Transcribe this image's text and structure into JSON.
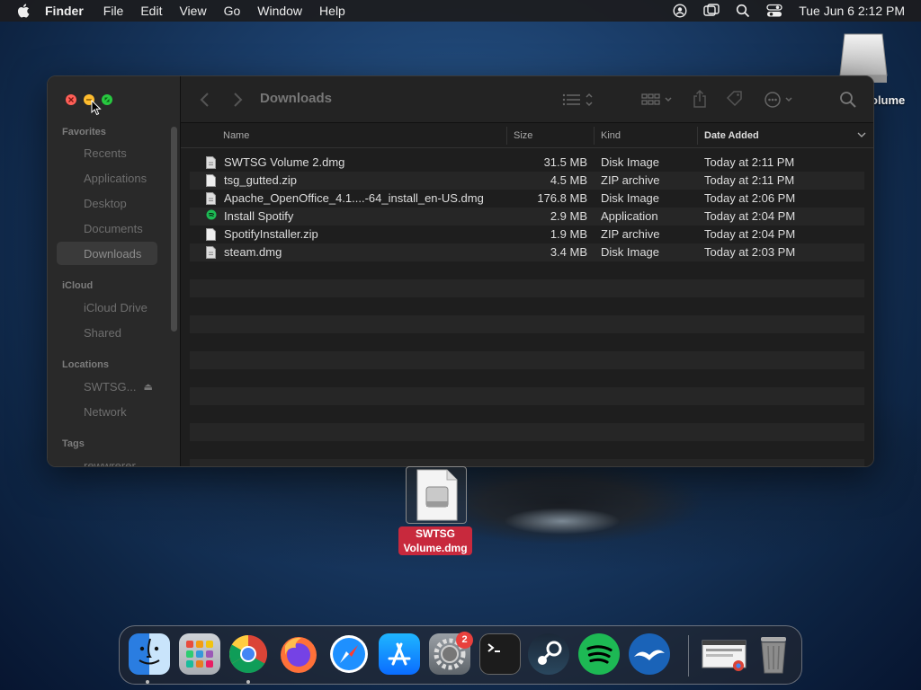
{
  "menubar": {
    "app_name": "Finder",
    "menus": [
      "File",
      "Edit",
      "View",
      "Go",
      "Window",
      "Help"
    ],
    "clock": "Tue Jun 6  2:12 PM",
    "status_icons": [
      "user-icon",
      "screen-mirror-icon",
      "search-icon",
      "control-center-icon"
    ]
  },
  "desktop": {
    "volume_label": "olume",
    "file_label_line1": "SWTSG",
    "file_label_line2": "Volume.dmg"
  },
  "finder": {
    "title": "Downloads",
    "sidebar": {
      "favorites_label": "Favorites",
      "favorites": [
        "Recents",
        "Applications",
        "Desktop",
        "Documents",
        "Downloads"
      ],
      "icloud_label": "iCloud",
      "icloud": [
        "iCloud Drive",
        "Shared"
      ],
      "locations_label": "Locations",
      "locations": [
        "SWTSG...",
        "Network"
      ],
      "tags_label": "Tags",
      "tags": [
        "rewwrerer"
      ]
    },
    "columns": {
      "name": "Name",
      "size": "Size",
      "kind": "Kind",
      "date": "Date Added"
    },
    "files": [
      {
        "name": "SWTSG Volume 2.dmg",
        "size": "31.5 MB",
        "kind": "Disk Image",
        "date": "Today at 2:11 PM",
        "icon": "document-icon"
      },
      {
        "name": "tsg_gutted.zip",
        "size": "4.5 MB",
        "kind": "ZIP archive",
        "date": "Today at 2:11 PM",
        "icon": "zip-icon"
      },
      {
        "name": "Apache_OpenOffice_4.1....-64_install_en-US.dmg",
        "size": "176.8 MB",
        "kind": "Disk Image",
        "date": "Today at 2:06 PM",
        "icon": "document-icon"
      },
      {
        "name": "Install Spotify",
        "size": "2.9 MB",
        "kind": "Application",
        "date": "Today at 2:04 PM",
        "icon": "spotify-icon"
      },
      {
        "name": "SpotifyInstaller.zip",
        "size": "1.9 MB",
        "kind": "ZIP archive",
        "date": "Today at 2:04 PM",
        "icon": "zip-icon"
      },
      {
        "name": "steam.dmg",
        "size": "3.4 MB",
        "kind": "Disk Image",
        "date": "Today at 2:03 PM",
        "icon": "document-icon"
      }
    ]
  },
  "dock": {
    "apps": [
      "Finder",
      "Launchpad",
      "Google Chrome",
      "Firefox",
      "Safari",
      "App Store",
      "System Preferences",
      "Terminal",
      "Steam",
      "Spotify",
      "OpenOffice",
      "Chrome Window",
      "Trash"
    ],
    "settings_badge": "2"
  },
  "colors": {
    "close": "#ff5f57",
    "minimize": "#febc2e",
    "maximize": "#28c840",
    "badge": "#e9403d",
    "file_label": "#c8293d"
  }
}
